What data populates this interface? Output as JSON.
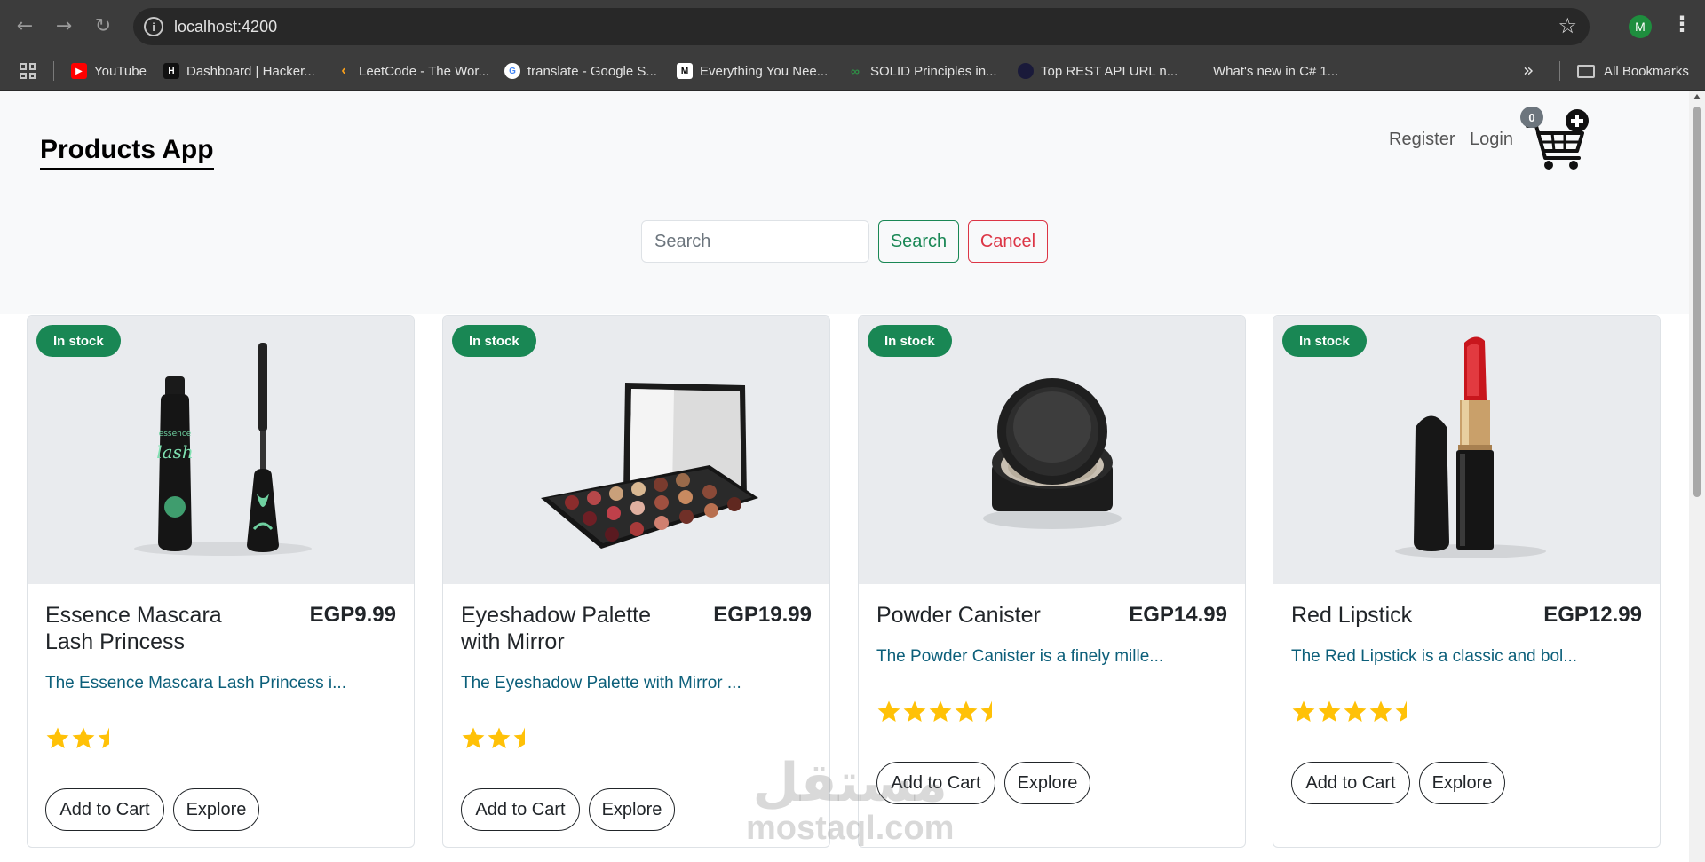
{
  "browser": {
    "url": "localhost:4200",
    "profile_initial": "M",
    "bookmarks": [
      {
        "label": "YouTube",
        "color": "#ff0000",
        "glyph": "▶"
      },
      {
        "label": "Dashboard | Hacker...",
        "color": "#111111",
        "glyph": "H"
      },
      {
        "label": "LeetCode - The Wor...",
        "color": "#3c3c3c",
        "glyph": "‹"
      },
      {
        "label": "translate - Google S...",
        "color": "#ffffff",
        "glyph": "G"
      },
      {
        "label": "Everything You Nee...",
        "color": "#000000",
        "glyph": "M"
      },
      {
        "label": "SOLID Principles in...",
        "color": "#3c3c3c",
        "glyph": "∞"
      },
      {
        "label": "Top REST API URL n...",
        "color": "#1a1a3a",
        "glyph": "●"
      },
      {
        "label": "What's new in C# 1...",
        "color": "#f25022",
        "glyph": "■"
      }
    ],
    "all_bookmarks_label": "All Bookmarks"
  },
  "header": {
    "brand": "Products App",
    "register_label": "Register",
    "login_label": "Login",
    "cart_count": "0"
  },
  "search": {
    "placeholder": "Search",
    "search_label": "Search",
    "cancel_label": "Cancel"
  },
  "products": [
    {
      "badge": "In stock",
      "title": "Essence Mascara Lash Princess",
      "price": "EGP9.99",
      "description": "The Essence Mascara Lash Princess i...",
      "rating": 2.5,
      "image": "mascara",
      "add_label": "Add to Cart",
      "explore_label": "Explore"
    },
    {
      "badge": "In stock",
      "title": "Eyeshadow Palette with Mirror",
      "price": "EGP19.99",
      "description": "The Eyeshadow Palette with Mirror ...",
      "rating": 2.5,
      "image": "eyeshadow-palette",
      "add_label": "Add to Cart",
      "explore_label": "Explore"
    },
    {
      "badge": "In stock",
      "title": "Powder Canister",
      "price": "EGP14.99",
      "description": "The Powder Canister is a finely mille...",
      "rating": 4.5,
      "image": "powder-canister",
      "add_label": "Add to Cart",
      "explore_label": "Explore"
    },
    {
      "badge": "In stock",
      "title": "Red Lipstick",
      "price": "EGP12.99",
      "description": "The Red Lipstick is a classic and bol...",
      "rating": 4.5,
      "image": "red-lipstick",
      "add_label": "Add to Cart",
      "explore_label": "Explore"
    }
  ],
  "watermark": {
    "arabic": "مستقل",
    "latin": "mostaql.com"
  },
  "colors": {
    "success": "#198754",
    "danger": "#dc3545",
    "star": "#ffc107",
    "link": "#0c5f7a"
  }
}
